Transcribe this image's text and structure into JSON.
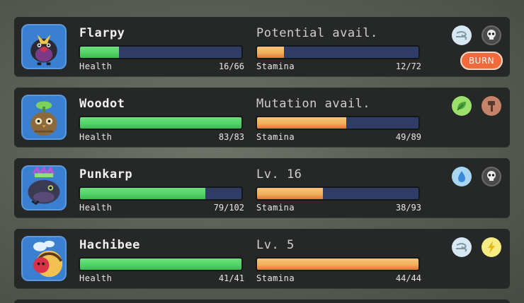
{
  "party": [
    {
      "name": "Flarpy",
      "info": "Potential avail.",
      "health": {
        "label": "Health",
        "value": "16/66",
        "fraction": 0.2424
      },
      "stamina": {
        "label": "Stamina",
        "value": "12/72",
        "fraction": 0.1667
      },
      "types": [
        "air-icon",
        "death-icon"
      ],
      "status": "BURN"
    },
    {
      "name": "Woodot",
      "info": "Mutation avail.",
      "health": {
        "label": "Health",
        "value": "83/83",
        "fraction": 1.0
      },
      "stamina": {
        "label": "Stamina",
        "value": "49/89",
        "fraction": 0.5506
      },
      "types": [
        "plant-icon",
        "hammer-icon"
      ]
    },
    {
      "name": "Punkarp",
      "info": "Lv. 16",
      "health": {
        "label": "Health",
        "value": "79/102",
        "fraction": 0.7745
      },
      "stamina": {
        "label": "Stamina",
        "value": "38/93",
        "fraction": 0.4086
      },
      "types": [
        "water-icon",
        "death-icon"
      ]
    },
    {
      "name": "Hachibee",
      "info": "Lv. 5",
      "health": {
        "label": "Health",
        "value": "41/41",
        "fraction": 1.0
      },
      "stamina": {
        "label": "Stamina",
        "value": "44/44",
        "fraction": 1.0
      },
      "types": [
        "air-icon",
        "lightning-icon"
      ]
    }
  ],
  "colors": {
    "card_bg": "#252826",
    "bar_bg": "#2f3d66",
    "health_fill": "#52d467",
    "stamina_fill": "#f2b05c",
    "burn_badge": "#f06a3c"
  }
}
